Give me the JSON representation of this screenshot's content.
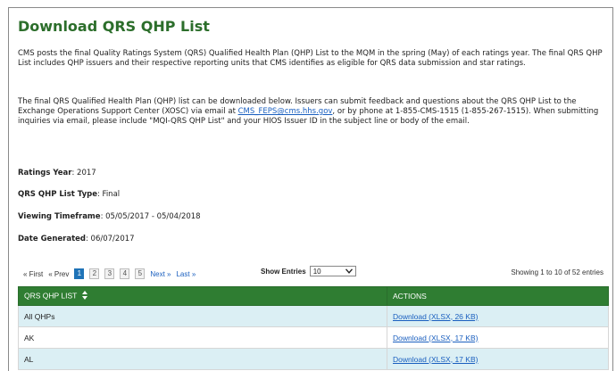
{
  "page": {
    "title": "Download QRS QHP List",
    "intro": "CMS posts the final Quality Ratings System (QRS) Qualified Health Plan (QHP) List to the MQM in the spring (May) of each ratings year. The final QRS QHP List includes QHP issuers and their respective reporting units that CMS identifies as eligible for QRS data submission and star ratings.",
    "para2_before": "The final QRS Qualified Health Plan (QHP) list can be downloaded below. Issuers can submit feedback and questions about the QRS QHP List to the Exchange Operations Support Center (XOSC) via email at ",
    "email": "CMS_FEPS@cms.hhs.gov",
    "para2_after": ", or by phone at 1-855-CMS-1515 (1-855-267-1515). When submitting inquiries via email, please include \"MQI-QRS QHP List\" and your HIOS Issuer ID in the subject line or body of the email."
  },
  "fields": {
    "ratings_year_label": "Ratings Year",
    "ratings_year_value": ": 2017",
    "list_type_label": "QRS QHP List Type",
    "list_type_value": ": Final",
    "timeframe_label": "Viewing Timeframe",
    "timeframe_value": ": 05/05/2017 - 05/04/2018",
    "date_label": "Date Generated",
    "date_value": ": 06/07/2017"
  },
  "pager": {
    "first": "« First",
    "prev": "« Prev",
    "pages": [
      "1",
      "2",
      "3",
      "4",
      "5"
    ],
    "active_page": "1",
    "next": "Next »",
    "last": "Last »"
  },
  "show_entries": {
    "label": "Show Entries",
    "value": "10"
  },
  "showing": "Showing 1 to 10 of 52 entries",
  "table": {
    "headers": [
      "QRS QHP LIST",
      "ACTIONS"
    ],
    "rows": [
      {
        "name": "All QHPs",
        "action": "Download (XLSX, 26 KB)"
      },
      {
        "name": "AK",
        "action": "Download (XLSX, 17 KB)"
      },
      {
        "name": "AL",
        "action": "Download (XLSX, 17 KB)"
      }
    ]
  },
  "icons": {
    "sort": "sort-icon",
    "dropdown": "chevron-down-icon"
  }
}
